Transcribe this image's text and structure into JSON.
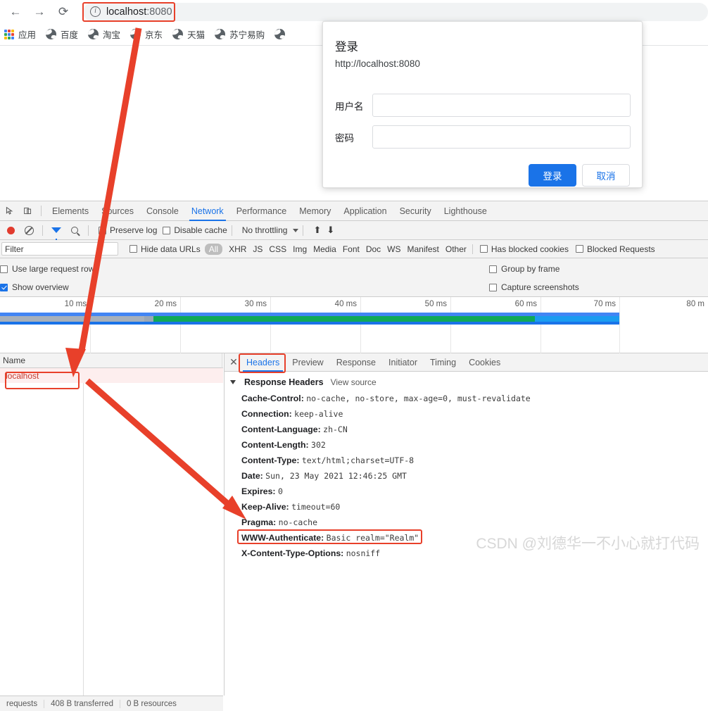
{
  "browser": {
    "nav": {
      "back": "←",
      "forward": "→",
      "reload": "⟳",
      "info": "i"
    },
    "url_main": "localhost",
    "url_port": ":8080",
    "bookmarks": [
      {
        "label": "应用",
        "icon": "apps-grid-icon"
      },
      {
        "label": "百度",
        "icon": "globe-icon"
      },
      {
        "label": "淘宝",
        "icon": "globe-icon"
      },
      {
        "label": "京东",
        "icon": "globe-icon"
      },
      {
        "label": "天猫",
        "icon": "globe-icon"
      },
      {
        "label": "苏宁易购",
        "icon": "globe-icon"
      },
      {
        "label": "",
        "icon": "globe-icon"
      }
    ]
  },
  "login_dialog": {
    "title": "登录",
    "origin": "http://localhost:8080",
    "username_label": "用户名",
    "username_value": "",
    "password_label": "密码",
    "password_value": "",
    "submit_label": "登录",
    "cancel_label": "取消"
  },
  "devtools": {
    "panels": [
      "Elements",
      "Sources",
      "Console",
      "Network",
      "Performance",
      "Memory",
      "Application",
      "Security",
      "Lighthouse"
    ],
    "active_panel": "Network",
    "toolbar": {
      "preserve_log": "Preserve log",
      "preserve_log_checked": false,
      "disable_cache": "Disable cache",
      "disable_cache_checked": false,
      "throttling": "No throttling",
      "import_icon": "upload-arrow-icon",
      "export_icon": "download-arrow-icon"
    },
    "filterbar": {
      "filter_placeholder": "Filter",
      "hide_data_urls": "Hide data URLs",
      "hide_data_urls_checked": false,
      "types": [
        "All",
        "XHR",
        "JS",
        "CSS",
        "Img",
        "Media",
        "Font",
        "Doc",
        "WS",
        "Manifest",
        "Other"
      ],
      "active_type": "All",
      "has_blocked_cookies": "Has blocked cookies",
      "has_blocked_cookies_checked": false,
      "blocked_requests": "Blocked Requests",
      "blocked_requests_checked": false
    },
    "options": {
      "use_large_request_rows": "Use large request rows",
      "use_large_request_rows_checked": false,
      "show_overview": "Show overview",
      "show_overview_checked": true,
      "group_by_frame": "Group by frame",
      "group_by_frame_checked": false,
      "capture_screenshots": "Capture screenshots",
      "capture_screenshots_checked": false
    },
    "overview": {
      "ticks": [
        "10 ms",
        "20 ms",
        "30 ms",
        "40 ms",
        "50 ms",
        "60 ms",
        "70 ms",
        "80 m"
      ]
    },
    "request_list": {
      "columns": [
        "Name"
      ],
      "rows": [
        {
          "name": "localhost"
        }
      ]
    },
    "details": {
      "tabs": [
        "Headers",
        "Preview",
        "Response",
        "Initiator",
        "Timing",
        "Cookies"
      ],
      "active_tab": "Headers",
      "section_title": "Response Headers",
      "view_source": "View source",
      "headers": [
        {
          "name": "Cache-Control:",
          "value": "no-cache, no-store, max-age=0, must-revalidate"
        },
        {
          "name": "Connection:",
          "value": "keep-alive"
        },
        {
          "name": "Content-Language:",
          "value": "zh-CN"
        },
        {
          "name": "Content-Length:",
          "value": "302"
        },
        {
          "name": "Content-Type:",
          "value": "text/html;charset=UTF-8"
        },
        {
          "name": "Date:",
          "value": "Sun, 23 May 2021 12:46:25 GMT"
        },
        {
          "name": "Expires:",
          "value": "0"
        },
        {
          "name": "Keep-Alive:",
          "value": "timeout=60"
        },
        {
          "name": "Pragma:",
          "value": "no-cache"
        },
        {
          "name": "WWW-Authenticate:",
          "value": "Basic realm=\"Realm\""
        },
        {
          "name": "X-Content-Type-Options:",
          "value": "nosniff"
        }
      ]
    },
    "statusbar": {
      "requests": "requests",
      "transferred": "408 B transferred",
      "resources": "0 B resources"
    }
  },
  "annotations": {
    "highlight_color": "#e8402a",
    "watermark": "CSDN @刘德华一不小心就打代码"
  }
}
